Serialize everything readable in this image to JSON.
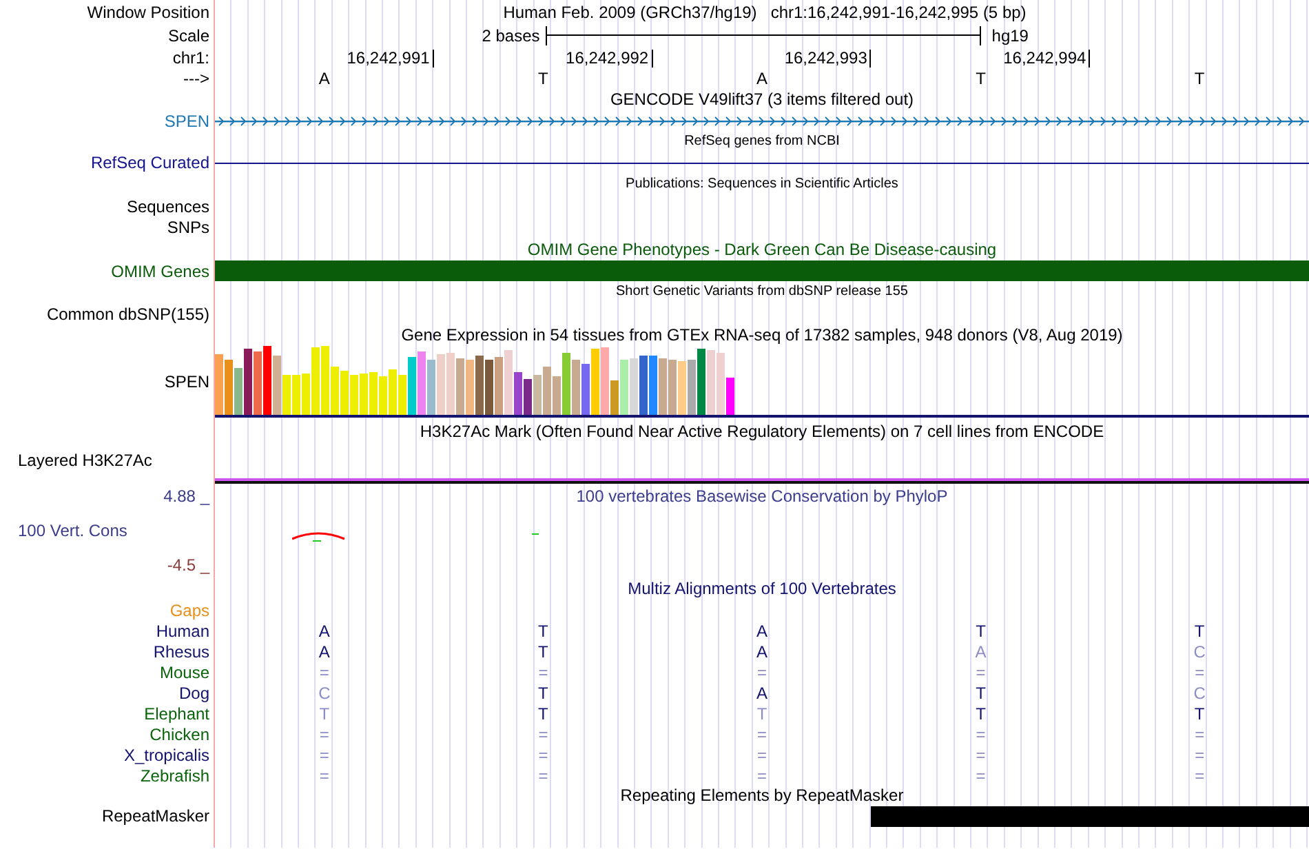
{
  "header": {
    "label": "Window Position",
    "assembly": "Human Feb. 2009 (GRCh37/hg19)",
    "position": "chr1:16,242,991-16,242,995 (5 bp)"
  },
  "scale": {
    "label": "Scale",
    "span": "2 bases",
    "db": "hg19"
  },
  "coordinates": {
    "label": "chr1:",
    "ticks": [
      "16,242,991",
      "16,242,992",
      "16,242,993",
      "16,242,994"
    ]
  },
  "sequence": {
    "label": "--->",
    "bases": [
      "A",
      "T",
      "A",
      "T",
      "T"
    ]
  },
  "tracks": [
    {
      "kind": "gene",
      "title": "GENCODE V49lift37 (3 items filtered out)",
      "labels": [
        "SPEN"
      ],
      "color": "#1f78b4"
    },
    {
      "kind": "line",
      "title": "RefSeq genes from NCBI",
      "labels": [
        "RefSeq Curated"
      ],
      "color": "#14148c"
    },
    {
      "kind": "empty",
      "title": "Publications: Sequences in Scientific Articles",
      "labels": [
        "Sequences",
        "SNPs"
      ],
      "color": "#000000"
    },
    {
      "kind": "bar",
      "title": "OMIM Gene Phenotypes - Dark Green Can Be Disease-causing",
      "labels": [
        "OMIM Genes"
      ],
      "color": "#0a5c0a"
    },
    {
      "kind": "empty",
      "title": "Short Genetic Variants from dbSNP release 155",
      "labels": [
        "Common dbSNP(155)"
      ],
      "color": "#000000"
    },
    {
      "kind": "expression",
      "title": "Gene Expression in 54 tissues from GTEx RNA-seq of 17382 samples, 948 donors (V8, Aug 2019)",
      "labels": [
        "SPEN"
      ],
      "color": "#000000"
    },
    {
      "kind": "signal",
      "title": "H3K27Ac Mark (Often Found Near Active Regulatory Elements) on 7 cell lines from ENCODE",
      "labels": [
        "Layered H3K27Ac"
      ],
      "color": "#000000"
    },
    {
      "kind": "conservation",
      "title": "100 vertebrates Basewise Conservation by PhyloP",
      "labels": [
        "100 Vert. Cons"
      ],
      "max": "4.88 _",
      "min": "-4.5 _",
      "color": "#3c3c8c"
    },
    {
      "kind": "alignment",
      "title": "Multiz Alignments of 100 Vertebrates",
      "color": "#14146e",
      "gaps": {
        "label": "Gaps",
        "color": "#e8901a"
      },
      "species": [
        {
          "name": "Human",
          "color": "#14146e",
          "bases": [
            {
              "base": "A",
              "faded": false
            },
            {
              "base": "T",
              "faded": false
            },
            {
              "base": "A",
              "faded": false
            },
            {
              "base": "T",
              "faded": false
            },
            {
              "base": "T",
              "faded": false
            }
          ]
        },
        {
          "name": "Rhesus",
          "color": "#14146e",
          "bases": [
            {
              "base": "A",
              "faded": false
            },
            {
              "base": "T",
              "faded": false
            },
            {
              "base": "A",
              "faded": false
            },
            {
              "base": "A",
              "faded": true
            },
            {
              "base": "C",
              "faded": true
            }
          ]
        },
        {
          "name": "Mouse",
          "color": "#0a640a",
          "bases": [
            {
              "base": "=",
              "faded": true
            },
            {
              "base": "=",
              "faded": true
            },
            {
              "base": "=",
              "faded": true
            },
            {
              "base": "=",
              "faded": true
            },
            {
              "base": "=",
              "faded": true
            }
          ]
        },
        {
          "name": "Dog",
          "color": "#14146e",
          "bases": [
            {
              "base": "C",
              "faded": true
            },
            {
              "base": "T",
              "faded": false
            },
            {
              "base": "A",
              "faded": false
            },
            {
              "base": "T",
              "faded": false
            },
            {
              "base": "C",
              "faded": true
            }
          ]
        },
        {
          "name": "Elephant",
          "color": "#0a640a",
          "bases": [
            {
              "base": "T",
              "faded": true
            },
            {
              "base": "T",
              "faded": false
            },
            {
              "base": "T",
              "faded": true
            },
            {
              "base": "T",
              "faded": false
            },
            {
              "base": "T",
              "faded": false
            }
          ]
        },
        {
          "name": "Chicken",
          "color": "#0a640a",
          "bases": [
            {
              "base": "=",
              "faded": true
            },
            {
              "base": "=",
              "faded": true
            },
            {
              "base": "=",
              "faded": true
            },
            {
              "base": "=",
              "faded": true
            },
            {
              "base": "=",
              "faded": true
            }
          ]
        },
        {
          "name": "X_tropicalis",
          "color": "#14146e",
          "bases": [
            {
              "base": "=",
              "faded": true
            },
            {
              "base": "=",
              "faded": true
            },
            {
              "base": "=",
              "faded": true
            },
            {
              "base": "=",
              "faded": true
            },
            {
              "base": "=",
              "faded": true
            }
          ]
        },
        {
          "name": "Zebrafish",
          "color": "#0a640a",
          "bases": [
            {
              "base": "=",
              "faded": true
            },
            {
              "base": "=",
              "faded": true
            },
            {
              "base": "=",
              "faded": true
            },
            {
              "base": "=",
              "faded": true
            },
            {
              "base": "=",
              "faded": true
            }
          ]
        }
      ]
    },
    {
      "kind": "repeat",
      "title": "Repeating Elements by RepeatMasker",
      "labels": [
        "RepeatMasker"
      ],
      "color": "#000000"
    }
  ]
}
